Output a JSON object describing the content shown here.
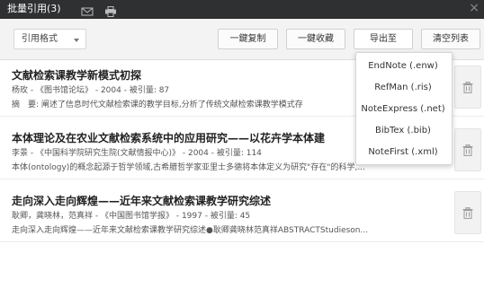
{
  "window": {
    "title": "批量引用(3)"
  },
  "toolbar": {
    "format_select": {
      "label": "引用格式"
    },
    "copy_button": "一鍵复制",
    "save_button": "一鍵收藏",
    "export_button": "导出至",
    "clear_button": "清空列表"
  },
  "export_menu": [
    {
      "label": "EndNote (.enw)"
    },
    {
      "label": "RefMan (.ris)"
    },
    {
      "label": "NoteExpress (.net)"
    },
    {
      "label": "BibTex (.bib)"
    },
    {
      "label": "NoteFirst (.xml)"
    }
  ],
  "records": [
    {
      "title": "文献检索课教学新模式初探",
      "meta": "杨玫 - 《图书馆论坛》 - 2004 - 被引量: 87",
      "abstract": "摘　要: 阐述了信息时代文献检索课的教学目标,分析了传统文献检索课教学模式存"
    },
    {
      "title": "本体理论及在农业文献检索系统中的应用研究——以花卉学本体建",
      "meta": "李景 - 《中国科学院研究生院(文献情报中心)》 - 2004 - 被引量: 114",
      "abstract": "本体(ontology)的概念起源于哲学领域,古希腊哲学家亚里士多德将本体定义为研究\"存在\"的科学,..."
    },
    {
      "title": "走向深入走向辉煌——近年来文献检索课教学研究综述",
      "meta": "耿卿，龚晓林，范真祥 - 《中国图书馆学报》 - 1997 - 被引量: 45",
      "abstract": "走向深入走向辉煌——近年来文献检索课教学研究综述●耿卿龚晓林范真祥ABSTRACTStudieson..."
    }
  ],
  "colors": {
    "titlebar": "#2f3032",
    "toolbar": "#f3f3f3"
  }
}
